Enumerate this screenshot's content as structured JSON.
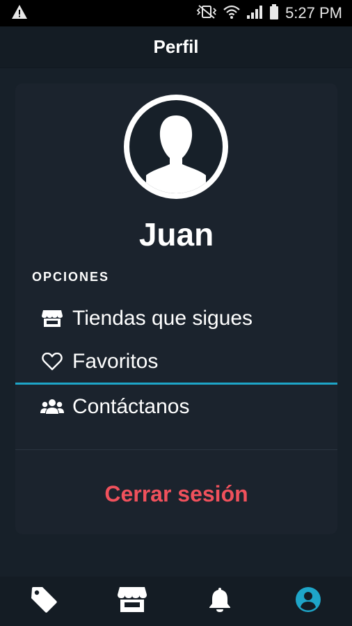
{
  "status_bar": {
    "time": "5:27 PM",
    "icons": [
      "warning-icon",
      "vibrate-icon",
      "wifi-icon",
      "signal-icon",
      "battery-icon"
    ]
  },
  "header": {
    "title": "Perfil"
  },
  "profile": {
    "avatar_icon": "user-silhouette-icon",
    "name": "Juan"
  },
  "options": {
    "section_label": "OPCIONES",
    "items": [
      {
        "label": "Tiendas que sigues",
        "icon": "store-icon"
      },
      {
        "label": "Favoritos",
        "icon": "heart-icon"
      },
      {
        "label": "Contáctanos",
        "icon": "users-icon"
      }
    ]
  },
  "logout_label": "Cerrar sesión",
  "bottom_nav": {
    "items": [
      {
        "icon": "tag-icon",
        "active": false
      },
      {
        "icon": "store-icon",
        "active": false
      },
      {
        "icon": "bell-icon",
        "active": false
      },
      {
        "icon": "user-circle-icon",
        "active": true
      }
    ]
  },
  "colors": {
    "accent": "#1ea5c8",
    "danger": "#f0515c",
    "background": "#172029",
    "card": "#1b232d"
  }
}
